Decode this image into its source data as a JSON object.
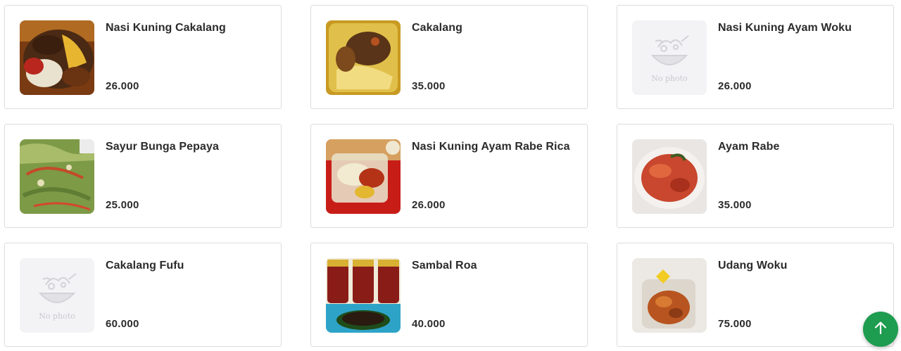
{
  "products": [
    {
      "name": "Nasi Kuning Cakalang",
      "price": "26.000",
      "image": "photo"
    },
    {
      "name": "Cakalang",
      "price": "35.000",
      "image": "photo"
    },
    {
      "name": "Nasi Kuning Ayam Woku",
      "price": "26.000",
      "image": "placeholder"
    },
    {
      "name": "Sayur Bunga Pepaya",
      "price": "25.000",
      "image": "photo"
    },
    {
      "name": "Nasi Kuning Ayam Rabe Rica",
      "price": "26.000",
      "image": "photo"
    },
    {
      "name": "Ayam Rabe",
      "price": "35.000",
      "image": "photo"
    },
    {
      "name": "Cakalang Fufu",
      "price": "60.000",
      "image": "placeholder"
    },
    {
      "name": "Sambal Roa",
      "price": "40.000",
      "image": "photo"
    },
    {
      "name": "Udang Woku",
      "price": "75.000",
      "image": "photo"
    }
  ],
  "placeholder_text": "No photo",
  "scroll_top_icon": "arrow-up-icon",
  "colors": {
    "accent_green": "#1e9c4f",
    "text": "#2b2b2b",
    "card_border": "#dcdcdc"
  }
}
